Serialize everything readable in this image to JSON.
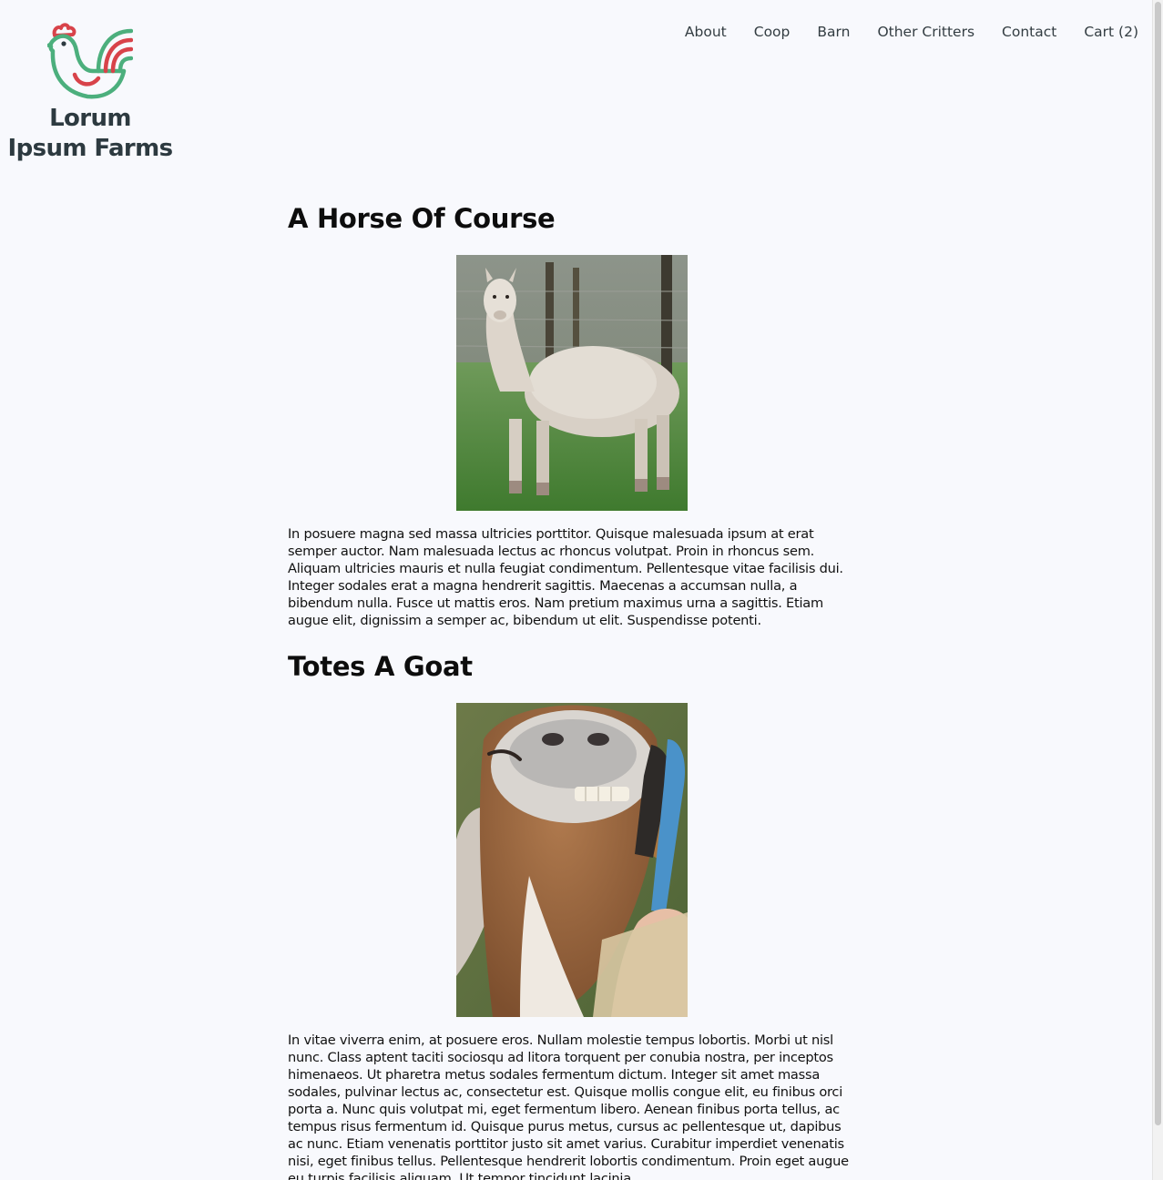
{
  "brand": {
    "line1": "Lorum",
    "line2": "Ipsum Farms",
    "colors": {
      "green": "#4caf7d",
      "red": "#d8434a",
      "text": "#2d3a40"
    }
  },
  "nav": {
    "about": "About",
    "coop": "Coop",
    "barn": "Barn",
    "other_critters": "Other Critters",
    "contact": "Contact",
    "cart": "Cart (2)"
  },
  "sections": [
    {
      "title": "A Horse Of Course",
      "image": "alpaca-photo",
      "body": "In posuere magna sed massa ultricies porttitor. Quisque malesuada ipsum at erat semper auctor. Nam malesuada lectus ac rhoncus volutpat. Proin in rhoncus sem. Aliquam ultricies mauris et nulla feugiat condimentum. Pellentesque vitae facilisis dui. Integer sodales erat a magna hendrerit sagittis. Maecenas a accumsan nulla, a bibendum nulla. Fusce ut mattis eros. Nam pretium maximus urna a sagittis. Etiam augue elit, dignissim a semper ac, bibendum ut elit. Suspendisse potenti."
    },
    {
      "title": "Totes A Goat",
      "image": "goat-photo",
      "body": "In vitae viverra enim, at posuere eros. Nullam molestie tempus lobortis. Morbi ut nisl nunc. Class aptent taciti sociosqu ad litora torquent per conubia nostra, per inceptos himenaeos. Ut pharetra metus sodales fermentum dictum. Integer sit amet massa sodales, pulvinar lectus ac, consectetur est. Quisque mollis congue elit, eu finibus orci porta a. Nunc quis volutpat mi, eget fermentum libero. Aenean finibus porta tellus, ac tempus risus fermentum id. Quisque purus metus, cursus ac pellentesque ut, dapibus ac nunc. Etiam venenatis porttitor justo sit amet varius. Curabitur imperdiet venenatis nisi, eget finibus tellus. Pellentesque hendrerit lobortis condimentum. Proin eget augue eu turpis facilisis aliquam. Ut tempor tincidunt lacinia."
    }
  ]
}
